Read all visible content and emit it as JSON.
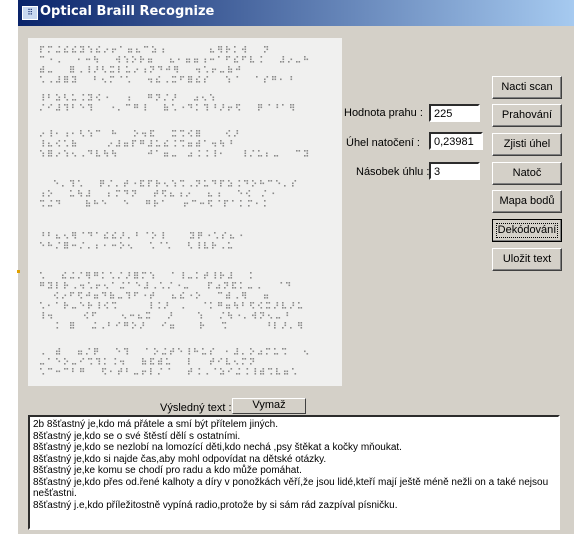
{
  "window": {
    "title": "Optical Braill Recognize"
  },
  "fields": {
    "threshold_label": "Hodnota prahu :",
    "threshold_value": "225",
    "angle_label": "Úhel natočení :",
    "angle_value": "0,23981",
    "multiplier_label": "Násobek úhlu :",
    "multiplier_value": "3"
  },
  "buttons": {
    "load_scan": "Nacti scan",
    "thresholding": "Prahování",
    "detect_angle": "Zjisti úhel",
    "rotate": "Natoč",
    "point_map": "Mapa bodů",
    "decode": "Dekódování",
    "save_text": "Uložit text",
    "clear": "Vymaž"
  },
  "result": {
    "label": "Výsledný text :",
    "lines": [
      "2b 8šťastný je,kdo má přátele a smí být přítelem jiných.",
      "8šťastný je,kdo se o své štěstí dělí s ostatními.",
      "8šťastný je,kdo se nezlobí na lomozící děti,kdo nechá ,psy štěkat a kočky mňoukat.",
      "8šťastný je,kdo si najde čas,aby mohl odpovídat na dětské otázky.",
      "8šťastný je,ke komu se chodí pro radu a kdo může pomáhat.",
      "8šťastný je,kdo přes od.řené kalhoty a díry v ponožkách věří,že jsou lidé,kteří mají ještě méně nežli on a také nejsou nešťastni.",
      "8šťastný j.e,kdo příležitostně vypíná radio,protože by si sám rád zazpíval písničku."
    ]
  },
  "icons": {
    "app": "app-icon"
  }
}
